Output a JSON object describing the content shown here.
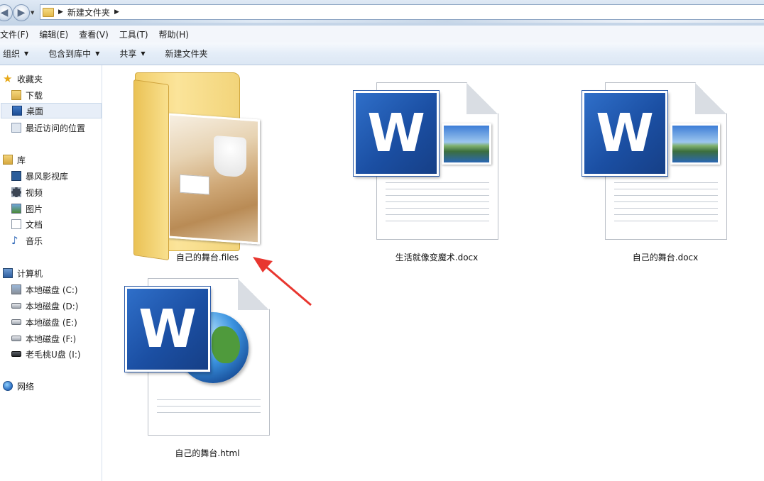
{
  "address": {
    "crumb": "新建文件夹",
    "sep1": "▶",
    "sep2": "▶"
  },
  "menu": [
    "文件(F)",
    "编辑(E)",
    "查看(V)",
    "工具(T)",
    "帮助(H)"
  ],
  "toolbar": {
    "organize": "组织",
    "include_in_library": "包含到库中",
    "share": "共享",
    "new_folder": "新建文件夹",
    "dropdown_glyph": "▼"
  },
  "sidebar": {
    "favorites": {
      "label": "收藏夹",
      "items": [
        "下载",
        "桌面",
        "最近访问的位置"
      ]
    },
    "libraries": {
      "label": "库",
      "items": [
        "暴风影视库",
        "视频",
        "图片",
        "文档",
        "音乐"
      ]
    },
    "computer": {
      "label": "计算机",
      "items": [
        "本地磁盘 (C:)",
        "本地磁盘 (D:)",
        "本地磁盘 (E:)",
        "本地磁盘 (F:)",
        "老毛桃U盘 (I:)"
      ]
    },
    "network": {
      "label": "网络"
    }
  },
  "files": [
    {
      "name": "自己的舞台.files",
      "icon": "folder-icon"
    },
    {
      "name": "生活就像变魔术.docx",
      "icon": "word-doc-icon"
    },
    {
      "name": "自己的舞台.docx",
      "icon": "word-doc-icon"
    },
    {
      "name": "自己的舞台.html",
      "icon": "word-html-icon"
    }
  ],
  "colors": {
    "accent": "#1b4fa3",
    "annotation_arrow": "#e8362f"
  }
}
